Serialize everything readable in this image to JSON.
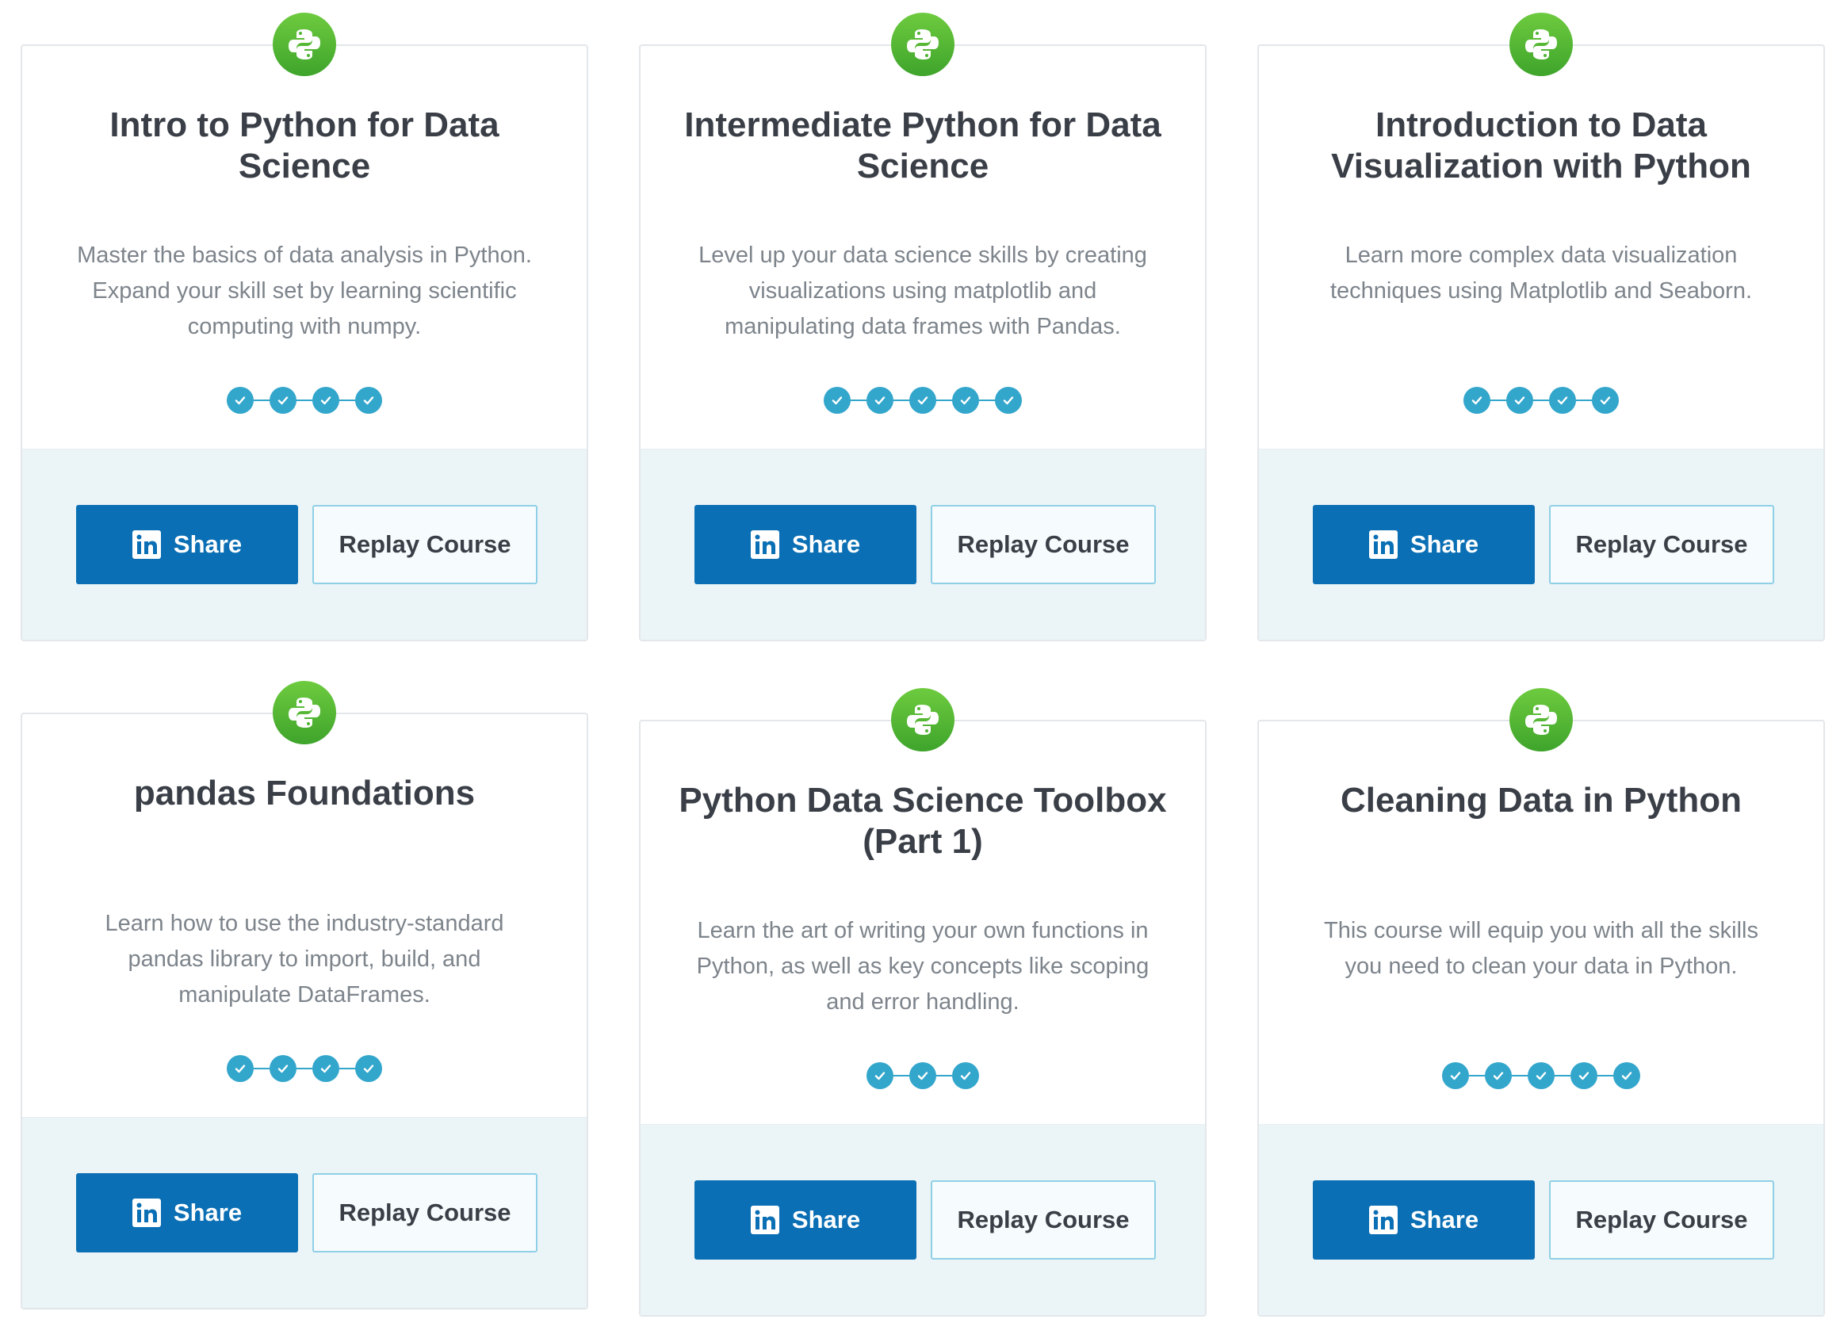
{
  "colors": {
    "badge_green": "#4fb534",
    "check_blue": "#33a6cc",
    "share_blue": "#0a6fb4",
    "footer_bg": "#ebf4f7"
  },
  "courses": [
    {
      "badge_icon": "python-icon",
      "title": "Intro to Python for Data Science",
      "description": "Master the basics of data analysis in Python. Expand your skill set by learning scientific computing with numpy.",
      "chapters_completed": 4,
      "share_label": "Share",
      "share_icon": "linkedin-icon",
      "replay_label": "Replay Course"
    },
    {
      "badge_icon": "python-icon",
      "title": "Intermediate Python for Data Science",
      "description": "Level up your data science skills by creating visualizations using matplotlib and manipulating data frames with Pandas.",
      "chapters_completed": 5,
      "share_label": "Share",
      "share_icon": "linkedin-icon",
      "replay_label": "Replay Course"
    },
    {
      "badge_icon": "python-icon",
      "title": "Introduction to Data Visualization with Python",
      "description": "Learn more complex data visualization techniques using Matplotlib and Seaborn.",
      "chapters_completed": 4,
      "share_label": "Share",
      "share_icon": "linkedin-icon",
      "replay_label": "Replay Course"
    },
    {
      "badge_icon": "python-icon",
      "title": "pandas Foundations",
      "description": "Learn how to use the industry-standard pandas library to import, build, and manipulate DataFrames.",
      "chapters_completed": 4,
      "share_label": "Share",
      "share_icon": "linkedin-icon",
      "replay_label": "Replay Course"
    },
    {
      "badge_icon": "python-icon",
      "title": "Python Data Science Toolbox (Part 1)",
      "description": "Learn the art of writing your own functions in Python, as well as key concepts like scoping and error handling.",
      "chapters_completed": 3,
      "share_label": "Share",
      "share_icon": "linkedin-icon",
      "replay_label": "Replay Course"
    },
    {
      "badge_icon": "python-icon",
      "title": "Cleaning Data in Python",
      "description": "This course will equip you with all the skills you need to clean your data in Python.",
      "chapters_completed": 5,
      "share_label": "Share",
      "share_icon": "linkedin-icon",
      "replay_label": "Replay Course"
    }
  ]
}
